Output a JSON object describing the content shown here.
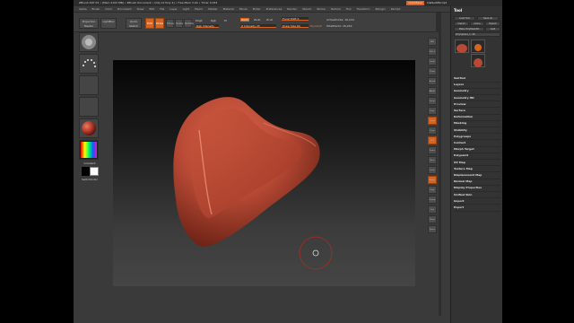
{
  "titlebar": {
    "text": "ZBrush 4R7 P3 • [Mem 2102 MB] • ZBrush Document • [Obj 12 Poly 4] • Free Mem 3.29 • Timer 0.033",
    "quicksave": "QuickSave",
    "default": "DefaultZScript"
  },
  "menubar": {
    "items": [
      "Alpha",
      "Brush",
      "Color",
      "Document",
      "Draw",
      "Edit",
      "File",
      "Layer",
      "Light",
      "Macro",
      "Marker",
      "Material",
      "Movie",
      "Picker",
      "Preferences",
      "Render",
      "Stencil",
      "Stroke",
      "Texture",
      "Tool",
      "Transform",
      "Zplugin",
      "Zscript"
    ]
  },
  "topshelf": {
    "projection_master": "Projection Master",
    "lightbox": "LightBox",
    "quick_sketch": "Quick Sketch",
    "edit": "Edit",
    "draw": "Draw",
    "move": "Move",
    "scale": "Scale",
    "rotate": "Rotate",
    "mrgb": "Mrgb",
    "rgb": "Rgb",
    "m": "M",
    "zadd": "Zadd",
    "zsub": "Zsub",
    "zcut": "Zcut",
    "rgb_intensity": "Rgb Intensity",
    "z_intensity": "Z Intensity 25",
    "focal_shift": "Focal Shift 0",
    "draw_size": "Draw Size 64",
    "active_points": "ActivePoints: 16,244",
    "total_points": "TotalPoints: 16,244",
    "dynamic": "Dynamic"
  },
  "leftshelf": {
    "gradient": "Gradient",
    "switchcolor": "SwitchColor",
    "alternate": "Alternate"
  },
  "rightshelf": {
    "buttons": [
      "BPR",
      "SPix 3",
      "Scroll",
      "Zoom",
      "Actual",
      "AAHalf",
      "Persp",
      "Floor",
      "Local",
      "LSym",
      "XYZ",
      "Frame",
      "Move",
      "Scale",
      "Rotate",
      "PolyF",
      "Transp",
      "Solo",
      "Ghost",
      "Xpose"
    ]
  },
  "tray": {
    "title": "Tool",
    "load_tool": "Load Tool",
    "save_as": "Save As",
    "copy_tool": "Copy Tool",
    "paste_tool": "Paste Tool",
    "import": "Import",
    "export": "Export",
    "clone": "Clone",
    "make_polymesh": "Make PolyMesh3D",
    "goz": "GoZ",
    "all": "All",
    "visible": "Visible",
    "r": "R",
    "current_tool": "PolySphere_1: 48",
    "tool_thumbs": [
      "PolySphere",
      "SimpleBrush",
      "PolySphere_1"
    ],
    "sections": [
      "SubTool",
      "Layers",
      "Geometry",
      "Geometry HD",
      "Preview",
      "Surface",
      "Deformation",
      "Masking",
      "Visibility",
      "Polygroups",
      "Contact",
      "Morph Target",
      "Polypaint",
      "UV Map",
      "Texture Map",
      "Displacement Map",
      "Normal Map",
      "Display Properties",
      "Unified Skin",
      "Import",
      "Export"
    ]
  },
  "colors": {
    "accent": "#d8631d",
    "clay": "#b84a35",
    "background": "#3a3a3a"
  },
  "cursor_icon": "brush-circle-icon",
  "dock_icon": "gear-icon"
}
